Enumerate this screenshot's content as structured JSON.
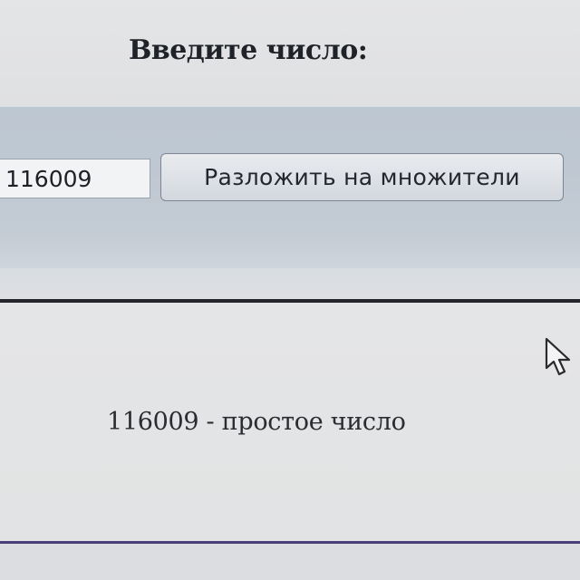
{
  "form": {
    "prompt_label": "Введите число:",
    "number_value": "116009",
    "submit_label": "Разложить на множители"
  },
  "result": {
    "text": "116009 - простое число"
  },
  "icons": {
    "cursor": "mouse-pointer-icon"
  },
  "colors": {
    "form_band": "#bfc8d2",
    "divider": "#24232e",
    "bottom_line": "#4a3f78"
  }
}
